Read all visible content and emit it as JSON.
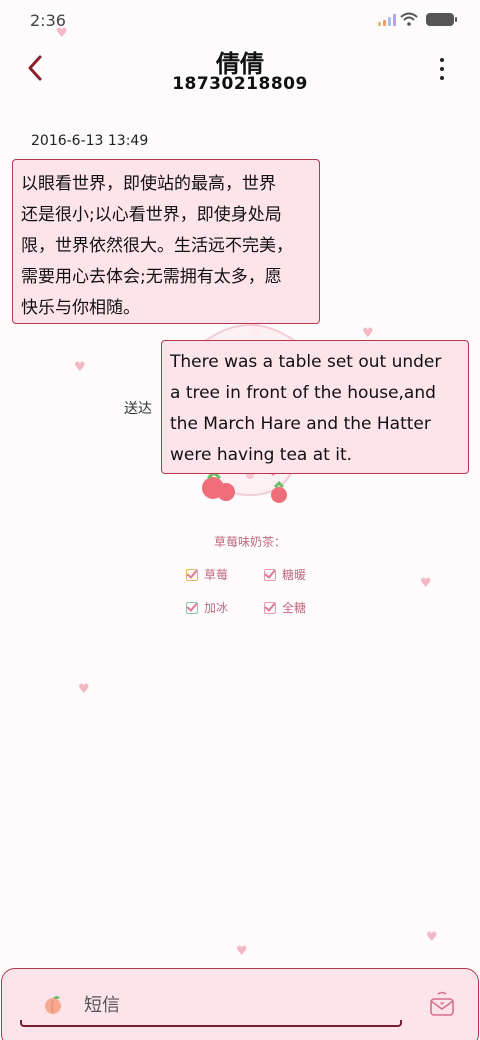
{
  "status_bar": {
    "time": "2:36",
    "icons": [
      "signal-icon",
      "wifi-icon",
      "battery-icon"
    ]
  },
  "header": {
    "contact_name": "倩倩",
    "phone_number": "18730218809",
    "back_icon": "chevron-left-icon",
    "menu_icon": "more-vertical-icon"
  },
  "conversation": {
    "timestamp": "2016-6-13 13:49",
    "incoming": {
      "lines": [
        "以眼看世界，即使站的最高，世界",
        "还是很小;以心看世界，即使身处局",
        "限，世界依然很大。生活远不完美，",
        "需要用心去体会;无需拥有太多，愿",
        "快乐与你相随。"
      ]
    },
    "outgoing": {
      "lines": [
        "There was a table set out under",
        "a tree in front of the house,and",
        "the March Hare and the Hatter",
        "were having tea at it."
      ],
      "status": "送达"
    }
  },
  "wallpaper": {
    "caption": "草莓味奶茶：",
    "options": [
      {
        "label": "草莓"
      },
      {
        "label": "糖暖"
      },
      {
        "label": "加冰"
      },
      {
        "label": "全糖"
      }
    ]
  },
  "composer": {
    "placeholder": "短信",
    "left_icon": "peach-icon",
    "send_icon": "envelope-send-icon"
  },
  "colors": {
    "accent": "#b3384f",
    "bubble_fill": "#fde3ea",
    "dark_accent": "#7a1f2f"
  }
}
